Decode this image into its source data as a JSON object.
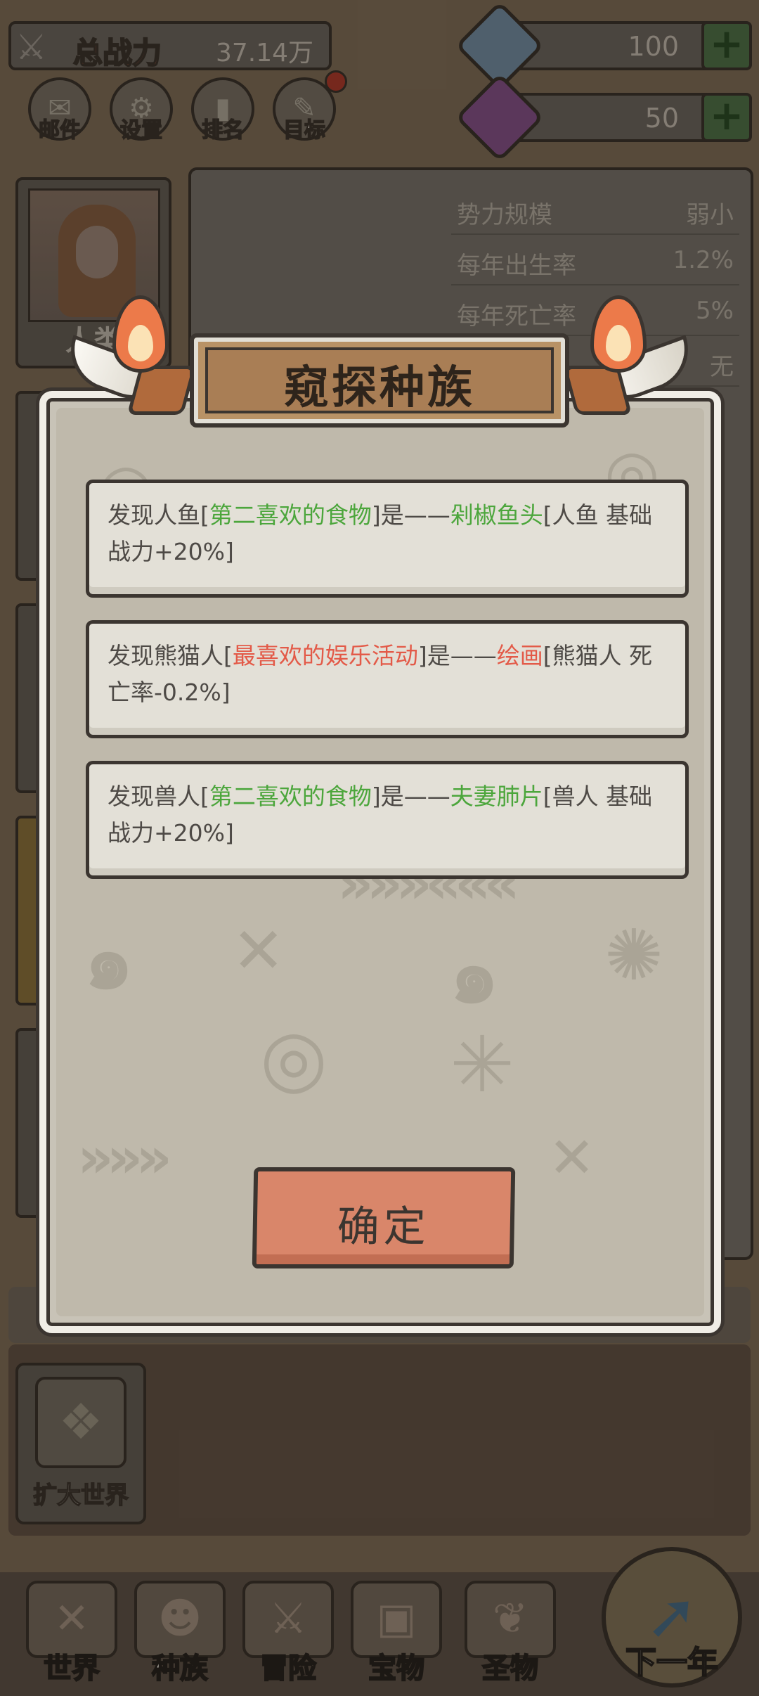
{
  "header": {
    "power_label": "总战力",
    "power_value": "37.14万",
    "resource_1": {
      "value": "100",
      "plus_label": "+",
      "color": "#7ea5c4"
    },
    "resource_2": {
      "value": "50",
      "plus_label": "+",
      "color": "#a34aa6"
    }
  },
  "menu": {
    "items": [
      {
        "label": "邮件",
        "icon": "mail-icon"
      },
      {
        "label": "设置",
        "icon": "gear-icon"
      },
      {
        "label": "排名",
        "icon": "ranking-icon"
      },
      {
        "label": "目标",
        "icon": "goal-icon"
      }
    ]
  },
  "avatar": {
    "name": "人类"
  },
  "stats": [
    {
      "key": "势力规模",
      "value": "弱小"
    },
    {
      "key": "每年出生率",
      "value": "1.2%"
    },
    {
      "key": "每年死亡率",
      "value": "5%"
    },
    {
      "key": "",
      "value": "无"
    }
  ],
  "expand_world": {
    "label": "扩大世界"
  },
  "bottom_nav": {
    "items": [
      {
        "label": "世界",
        "icon": "world-icon"
      },
      {
        "label": "种族",
        "icon": "race-icon"
      },
      {
        "label": "冒险",
        "icon": "adventure-icon"
      },
      {
        "label": "宝物",
        "icon": "treasure-icon"
      },
      {
        "label": "圣物",
        "icon": "relic-icon"
      }
    ],
    "next_year_label": "下一年"
  },
  "modal": {
    "title": "窥探种族",
    "messages": [
      {
        "parts": [
          {
            "text": "发现人鱼[",
            "style": "normal"
          },
          {
            "text": "第二喜欢的食物",
            "style": "green"
          },
          {
            "text": "]是——",
            "style": "normal"
          },
          {
            "text": "剁椒鱼头",
            "style": "green"
          },
          {
            "text": "[人鱼 基础战力+20%]",
            "style": "normal"
          }
        ]
      },
      {
        "parts": [
          {
            "text": "发现熊猫人[",
            "style": "normal"
          },
          {
            "text": "最喜欢的娱乐活动",
            "style": "red"
          },
          {
            "text": "]是——",
            "style": "normal"
          },
          {
            "text": "绘画",
            "style": "red"
          },
          {
            "text": "[熊猫人 死亡率-0.2%]",
            "style": "normal"
          }
        ]
      },
      {
        "parts": [
          {
            "text": "发现兽人[",
            "style": "normal"
          },
          {
            "text": "第二喜欢的食物",
            "style": "green"
          },
          {
            "text": "]是——",
            "style": "normal"
          },
          {
            "text": "夫妻肺片",
            "style": "green"
          },
          {
            "text": "[兽人 基础战力+20%]",
            "style": "normal"
          }
        ]
      }
    ],
    "confirm_label": "确定"
  },
  "colors": {
    "highlight_green": "#4ca63c",
    "highlight_red": "#e35a48",
    "confirm_button": "#d9866a",
    "title_plate": "#a97e55"
  }
}
